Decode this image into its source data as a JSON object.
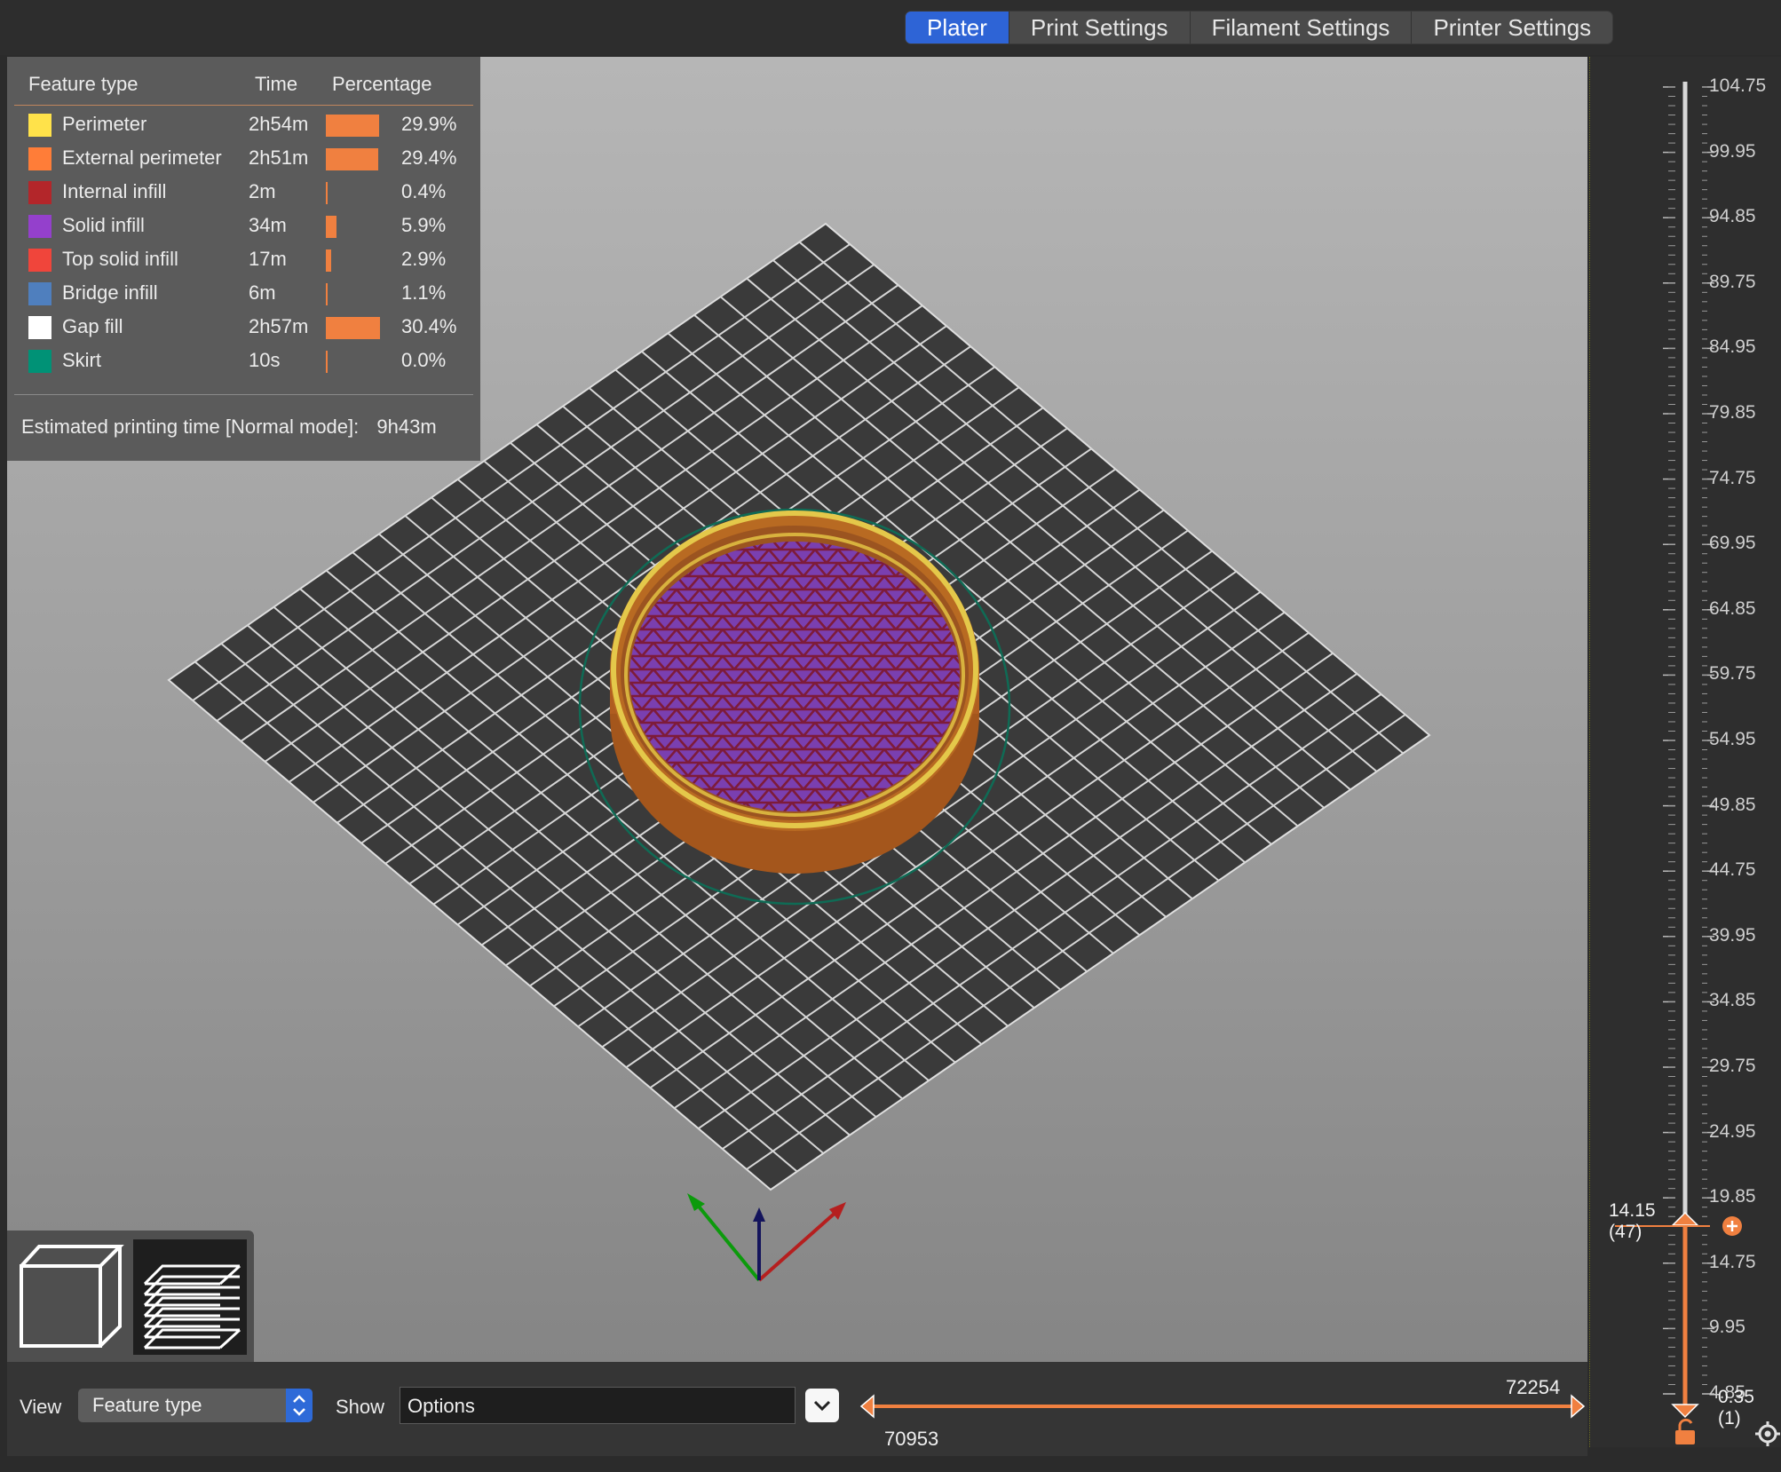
{
  "tabs": [
    "Plater",
    "Print Settings",
    "Filament Settings",
    "Printer Settings"
  ],
  "legend": {
    "headers": {
      "feature": "Feature type",
      "time": "Time",
      "percentage": "Percentage"
    },
    "rows": [
      {
        "name": "Perimeter",
        "time": "2h54m",
        "pct": "29.9%",
        "frac": 0.299,
        "color": "#ffe24a"
      },
      {
        "name": "External perimeter",
        "time": "2h51m",
        "pct": "29.4%",
        "frac": 0.294,
        "color": "#ff7d38"
      },
      {
        "name": "Internal infill",
        "time": "2m",
        "pct": "0.4%",
        "frac": 0.004,
        "color": "#b3262a"
      },
      {
        "name": "Solid infill",
        "time": "34m",
        "pct": "5.9%",
        "frac": 0.059,
        "color": "#9440cc"
      },
      {
        "name": "Top solid infill",
        "time": "17m",
        "pct": "2.9%",
        "frac": 0.029,
        "color": "#f0453b"
      },
      {
        "name": "Bridge infill",
        "time": "6m",
        "pct": "1.1%",
        "frac": 0.011,
        "color": "#4f7fbe"
      },
      {
        "name": "Gap fill",
        "time": "2h57m",
        "pct": "30.4%",
        "frac": 0.304,
        "color": "#ffffff"
      },
      {
        "name": "Skirt",
        "time": "10s",
        "pct": "0.0%",
        "frac": 0.0,
        "color": "#009276"
      }
    ],
    "estimate_label": "Estimated printing time [Normal mode]:",
    "estimate_value": "9h43m"
  },
  "bottom": {
    "view_label": "View",
    "view_value": "Feature type",
    "show_label": "Show",
    "show_value": "Options",
    "move_min": "70953",
    "move_max": "72254"
  },
  "layer_slider": {
    "ticks": [
      "104.75",
      "99.95",
      "94.85",
      "89.75",
      "84.95",
      "79.85",
      "74.75",
      "69.95",
      "64.85",
      "59.75",
      "54.95",
      "49.85",
      "44.75",
      "39.95",
      "34.85",
      "29.75",
      "24.95",
      "19.85",
      "14.75",
      "9.95",
      "4.85"
    ],
    "upper_value": "14.15",
    "upper_layer": "(47)",
    "lower_value": "0.35",
    "lower_layer": "(1)"
  },
  "colors": {
    "accent": "#2e64d6",
    "slider": "#f08040",
    "bed": "#3a3a3a"
  },
  "icons": {
    "view3d": "cube-icon",
    "preview": "layers-icon",
    "lock": "lock-icon",
    "settings": "gear-icon"
  }
}
